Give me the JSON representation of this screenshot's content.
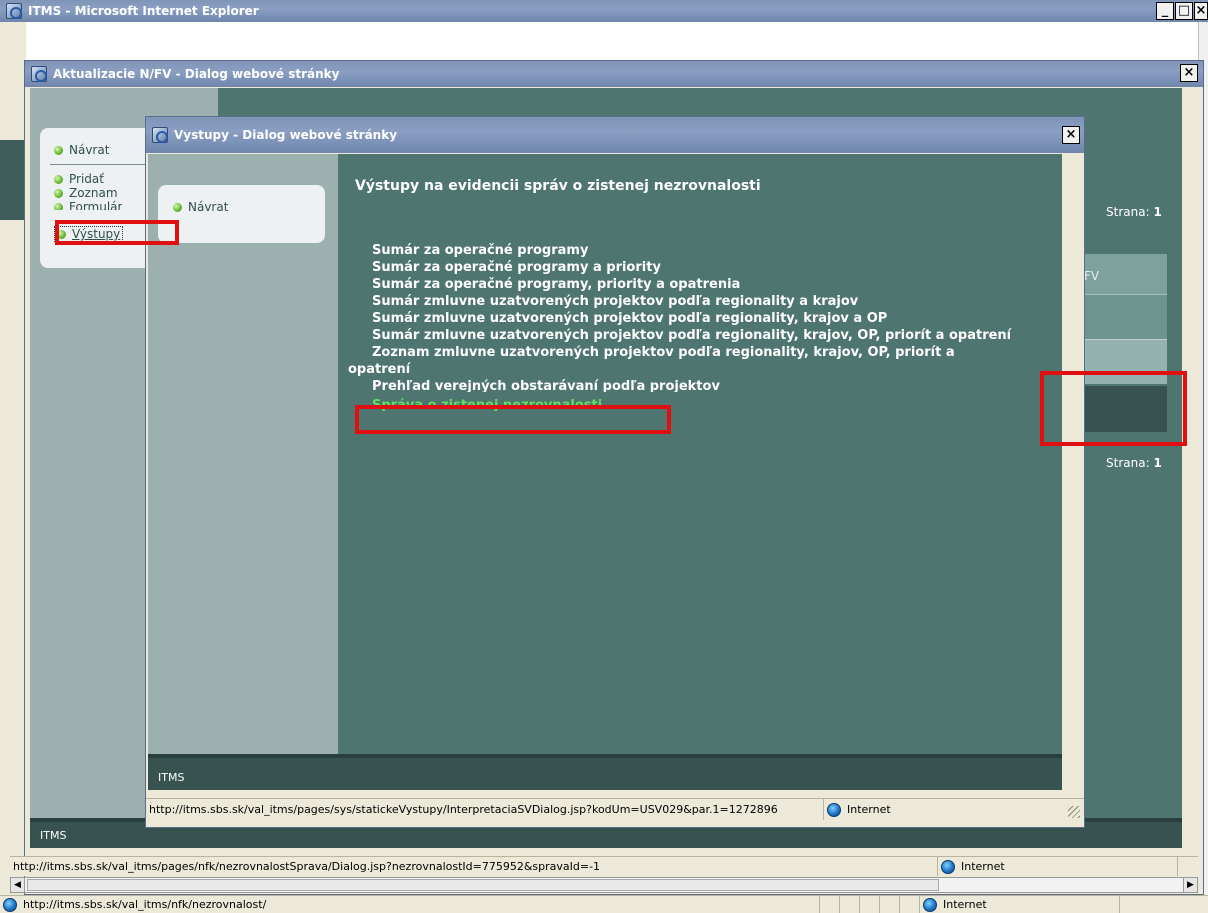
{
  "ie_window": {
    "title": "ITMS - Microsoft Internet Explorer",
    "status_url": "http://itms.sbs.sk/val_itms/nfk/nezrovnalost/",
    "zone": "Internet",
    "controls": {
      "minimize": "_",
      "maximize": "□",
      "close": "×"
    }
  },
  "dialog1": {
    "title": "Aktualizacie N/FV - Dialog webové stránky",
    "close": "×",
    "nav": [
      {
        "label": "Návrat"
      },
      {
        "label": "Pridať"
      },
      {
        "label": "Zoznam"
      },
      {
        "label": "Formulár"
      },
      {
        "label": "Výstupy"
      }
    ],
    "page_label_top": "Strana: ",
    "page_num_top": "1",
    "page_label_bottom": "Strana: ",
    "page_num_bottom": "1",
    "column_fragment": "FV",
    "footer": "ITMS",
    "status_url": "http://itms.sbs.sk/val_itms/pages/nfk/nezrovnalostSprava/Dialog.jsp?nezrovnalostId=775952&spravaId=-1",
    "zone": "Internet"
  },
  "dialog2": {
    "title": "Vystupy - Dialog webové stránky",
    "close": "×",
    "nav_back": "Návrat",
    "heading": "Výstupy na evidencii správ o zistenej nezrovnalosti",
    "reports": [
      "Sumár za operačné programy",
      "Sumár za operačné programy a priority",
      "Sumár za operačné programy, priority a opatrenia",
      "Sumár zmluvne uzatvorených projektov podľa regionality a krajov",
      "Sumár zmluvne uzatvorených projektov podľa regionality, krajov a OP",
      "Sumár zmluvne uzatvorených projektov podľa regionality, krajov, OP, priorít a opatrení",
      "Zoznam zmluvne uzatvorených projektov podľa regionality, krajov, OP, priorít a",
      "opatrení",
      "Prehľad verejných obstarávaní podľa projektov",
      "Správa o zistenej nezrovnalosti"
    ],
    "footer": "ITMS",
    "status_url": "http://itms.sbs.sk/val_itms/pages/sys/statickeVystupy/InterpretaciaSVDialog.jsp?kodUm=USV029&par.1=1272896",
    "zone": "Internet"
  },
  "colors": {
    "teal_bg": "#4f7571",
    "dark_teal": "#37524f",
    "sidebar_bg": "#9db0b0",
    "highlight_green": "#5fe05f",
    "annotation_red": "#e01010"
  }
}
